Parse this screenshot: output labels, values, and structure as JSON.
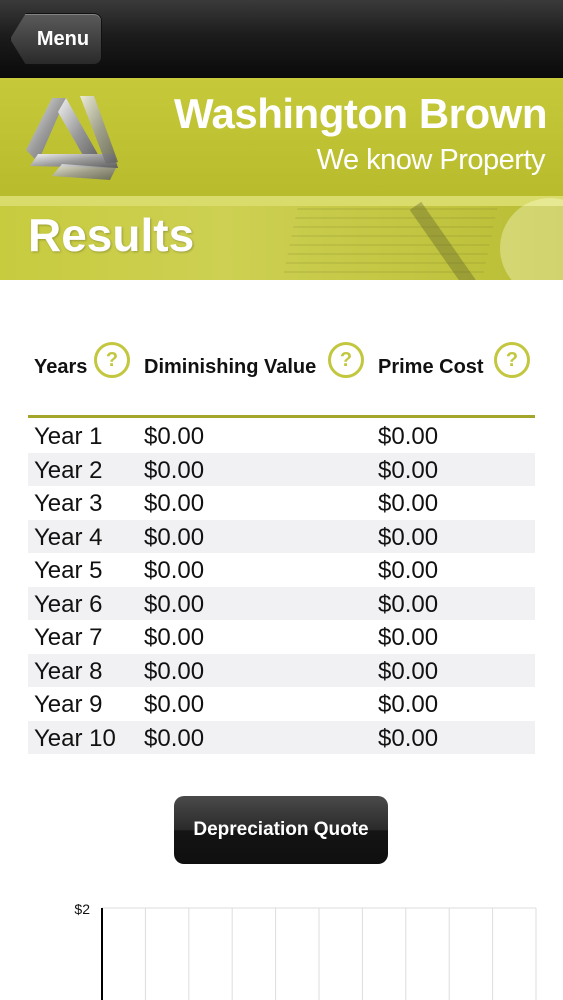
{
  "nav": {
    "menu_label": "Menu"
  },
  "brand": {
    "title": "Washington Brown",
    "tagline": "We know Property"
  },
  "page": {
    "title": "Results"
  },
  "table": {
    "headers": {
      "years": "Years",
      "diminishing": "Diminishing Value",
      "prime": "Prime Cost"
    },
    "help_glyph": "?",
    "rows": [
      {
        "year": "Year 1",
        "diminishing": "$0.00",
        "prime": "$0.00"
      },
      {
        "year": "Year 2",
        "diminishing": "$0.00",
        "prime": "$0.00"
      },
      {
        "year": "Year 3",
        "diminishing": "$0.00",
        "prime": "$0.00"
      },
      {
        "year": "Year 4",
        "diminishing": "$0.00",
        "prime": "$0.00"
      },
      {
        "year": "Year 5",
        "diminishing": "$0.00",
        "prime": "$0.00"
      },
      {
        "year": "Year 6",
        "diminishing": "$0.00",
        "prime": "$0.00"
      },
      {
        "year": "Year 7",
        "diminishing": "$0.00",
        "prime": "$0.00"
      },
      {
        "year": "Year 8",
        "diminishing": "$0.00",
        "prime": "$0.00"
      },
      {
        "year": "Year 9",
        "diminishing": "$0.00",
        "prime": "$0.00"
      },
      {
        "year": "Year 10",
        "diminishing": "$0.00",
        "prime": "$0.00"
      }
    ]
  },
  "quote_button": {
    "label": "Depreciation Quote"
  },
  "chart_data": {
    "type": "bar",
    "ytick_top": "$2",
    "categories_count": 10,
    "grid": true
  },
  "colors": {
    "accent": "#c2c73f",
    "brand_bg": "#bfc335",
    "rule": "#a3a52c"
  }
}
